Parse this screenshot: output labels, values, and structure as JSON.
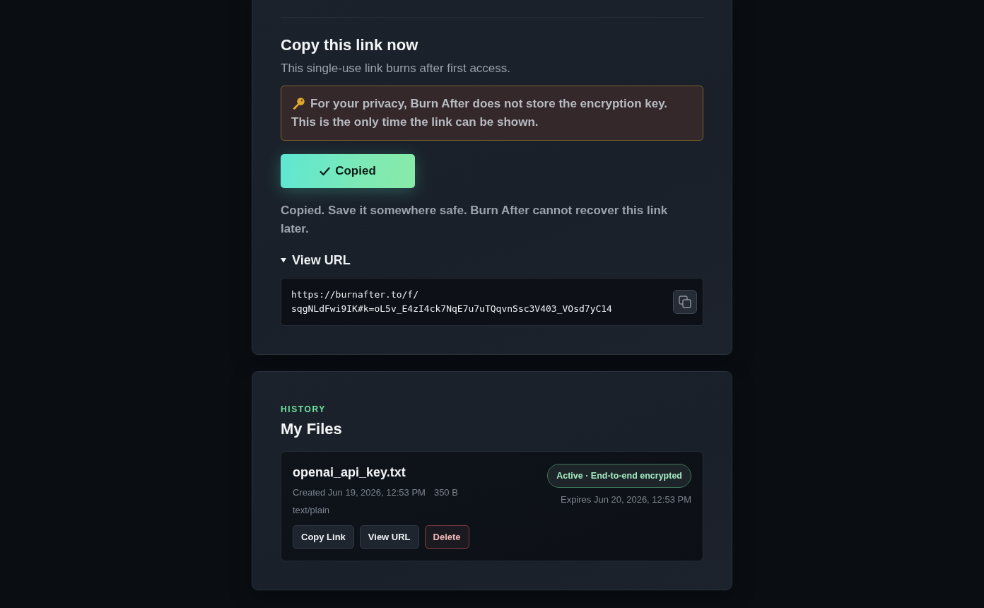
{
  "link_panel": {
    "title": "Copy this link now",
    "subtitle": "This single-use link burns after first access.",
    "warning": [
      "For your privacy, Burn After does not store the encryption key.",
      "This is the only time the link can be shown."
    ],
    "copy_button": {
      "label": "Copied",
      "copied": true
    },
    "confirmation": "Copied. Save it somewhere safe. Burn After cannot recover this link later.",
    "url_toggle": {
      "label": "View URL",
      "expanded": true
    },
    "url": "https://burnafter.to/f/sqgNLdFwi9IK#k=oL5v_E4zI4ck7NqE7u7uTQqvnSsc3V403_VOsd7yC14"
  },
  "history": {
    "eyebrow": "HISTORY",
    "title": "My Files",
    "files": [
      {
        "name": "openai_api_key.txt",
        "created": "Created Jun 19, 2026, 12:53 PM",
        "size": "350 B",
        "type": "text/plain",
        "status": {
          "label": "Active · End-to-end encrypted",
          "kind": "active"
        },
        "expires": "Expires Jun 20, 2026, 12:53 PM",
        "actions": [
          {
            "label": "Copy Link",
            "kind": "default"
          },
          {
            "label": "View URL",
            "kind": "default"
          },
          {
            "label": "Delete",
            "kind": "danger"
          }
        ]
      }
    ]
  }
}
